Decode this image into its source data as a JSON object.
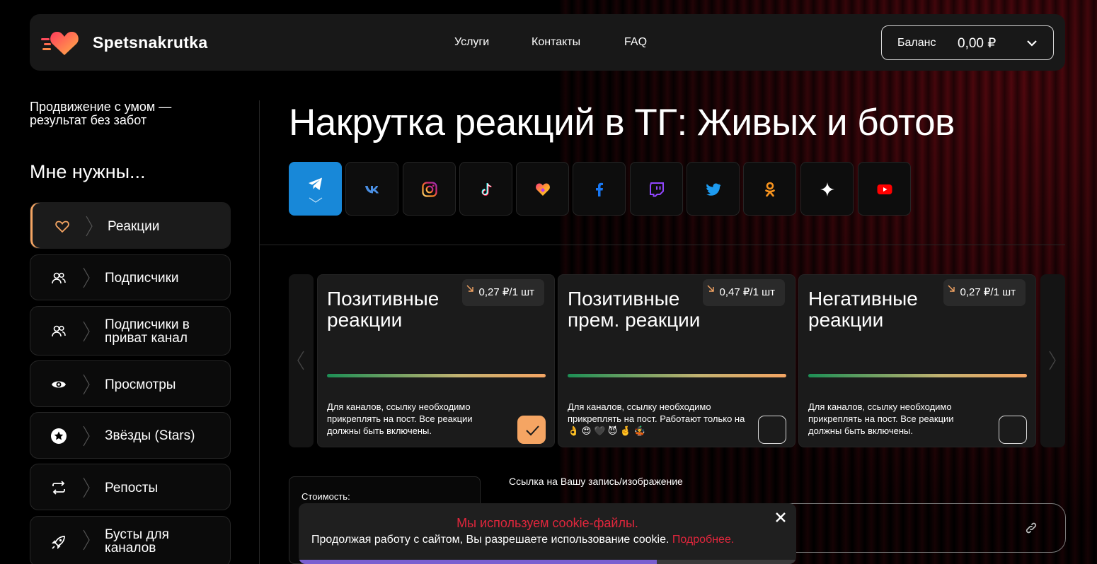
{
  "header": {
    "brand": "Spetsnakrutka",
    "nav": [
      "Услуги",
      "Контакты",
      "FAQ"
    ],
    "balance_label": "Баланс",
    "balance_value": "0,00 ₽"
  },
  "sidebar": {
    "tagline": "Продвижение с умом — результат без забот",
    "heading": "Мне нужны...",
    "items": [
      {
        "label": "Реакции",
        "icon": "heart-icon",
        "active": true
      },
      {
        "label": "Подписчики",
        "icon": "users-icon"
      },
      {
        "label": "Подписчики в приват канал",
        "icon": "users-icon"
      },
      {
        "label": "Просмотры",
        "icon": "eye-icon"
      },
      {
        "label": "Звёзды (Stars)",
        "icon": "star-icon"
      },
      {
        "label": "Репосты",
        "icon": "repost-icon"
      },
      {
        "label": "Бусты для каналов",
        "icon": "rocket-icon"
      }
    ]
  },
  "main": {
    "title": "Накрутка реакций в ТГ: Живых и ботов",
    "socials": [
      "telegram-icon",
      "vk-icon",
      "instagram-icon",
      "tiktok-icon",
      "likee-icon",
      "facebook-icon",
      "twitch-icon",
      "twitter-icon",
      "odnoklassniki-icon",
      "threads-icon",
      "youtube-icon"
    ],
    "cards": [
      {
        "title": "Позитивные реакции",
        "price": "0,27 ₽/1 шт",
        "desc": "Для каналов, ссылку необходимо прикреплять на пост. Все реакции должны быть включены.",
        "checked": true
      },
      {
        "title": "Позитивные прем. реакции",
        "price": "0,47 ₽/1 шт",
        "desc": "Для каналов, ссылку необходимо прикреплять на пост. Работают только на 👌 😍 🖤 😈 🤞 🤹",
        "checked": false
      },
      {
        "title": "Негативные реакции",
        "price": "0,27 ₽/1 шт",
        "desc": "Для каналов, ссылку необходимо прикреплять на пост. Все реакции должны быть включены.",
        "checked": false
      }
    ],
    "cost_label": "Стоимость:",
    "link_label": "Ссылка на Вашу запись/изображение"
  },
  "cookie": {
    "title": "Мы используем cookie-файлы.",
    "text": "Продолжая работу с сайтом, Вы разрешаете использование cookie.",
    "more": "Подробнее.",
    "progress": 0.72
  },
  "colors": {
    "accent": "#f5a563",
    "telegram": "#1888d8",
    "cookie_red": "#e0263c",
    "progress": "#7a5fd0"
  }
}
